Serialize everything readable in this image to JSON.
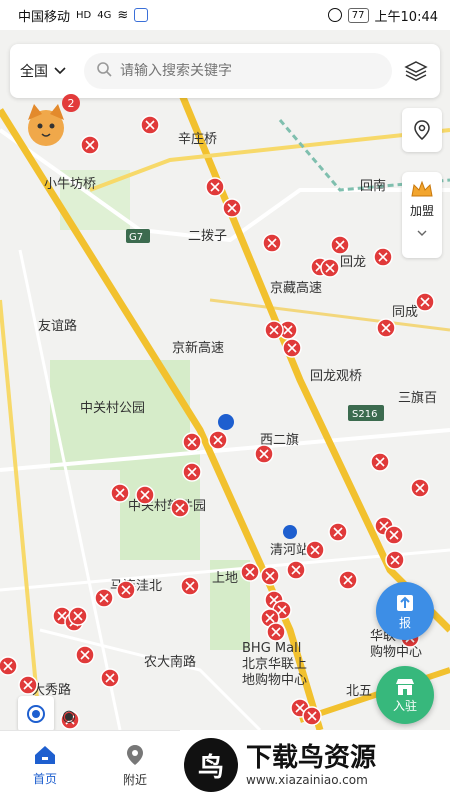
{
  "status_bar": {
    "carrier": "中国移动",
    "hd": "HD",
    "signal": "4G",
    "battery": "77",
    "time": "上午10:44"
  },
  "search_bar": {
    "region": "全国",
    "placeholder": "请输入搜索关键字"
  },
  "side_controls": {
    "join_label": "加盟"
  },
  "mascot": {
    "badge_count": "2"
  },
  "map_labels": {
    "xinzhuangqiao": "辛庄桥",
    "xiaoniufangqiao": "小牛坊桥",
    "g7": "G7",
    "erbozi": "二拨子",
    "huilongguan": "回龙",
    "tongcheng": "同成",
    "youdaolu": "友谊路",
    "jingzangkuaisu": "京藏高速",
    "jingxingaosu": "京新高速",
    "huilongguanqiao": "回龙观桥",
    "s216": "S216",
    "sanqibai": "三旗百",
    "zhongguancunpark": "中关村公园",
    "xierqi": "西二旗",
    "zhongguancun_soft_park": "中关村软件园",
    "qinghe_station": "清河站",
    "shangdi": "上地",
    "malianwa_north": "马连洼北",
    "bhg_mall": "BHG Mall",
    "beijing_hualian_1": "北京华联上",
    "beijing_hualian_2": "地购物中心",
    "huarun": "华联",
    "shopping_center": "购物中心",
    "nongda_south_road": "农大南路",
    "daxiulu": "大秀路",
    "beiwu": "北五",
    "huilong_road": "回南"
  },
  "buttons": {
    "report": "报",
    "enter": "入驻"
  },
  "tabs": [
    {
      "label": "首页",
      "icon": "home-icon"
    },
    {
      "label": "附近",
      "icon": "location-pin-icon"
    }
  ],
  "watermark": {
    "title": "下载鸟资源",
    "url": "www.xiazainiao.com"
  },
  "colors": {
    "accent_blue": "#1e5fcf",
    "marker_red": "#e03a3a",
    "highway_yellow": "#f2c12e",
    "report_blue": "#3d8ee6",
    "enter_green": "#37b87c",
    "park_green": "#cfe9c4"
  }
}
